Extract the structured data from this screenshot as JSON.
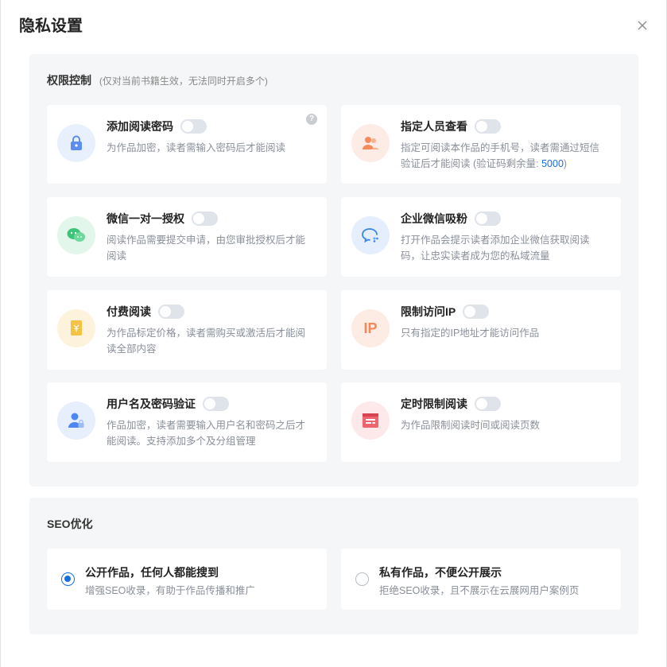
{
  "dialog": {
    "title": "隐私设置"
  },
  "permission": {
    "title": "权限控制",
    "note": "(仅对当前书籍生效，无法同时开启多个)",
    "cards": [
      {
        "title": "添加阅读密码",
        "desc": "为作品加密，读者需输入密码后才能阅读",
        "icon": "lock-icon",
        "enabled": false,
        "help": "?"
      },
      {
        "title": "指定人员查看",
        "desc_before": "指定可阅读本作品的手机号，读者需通过短信验证后才能阅读 (验证码剩余量: ",
        "quota": "5000",
        "desc_after": ")",
        "icon": "people-icon",
        "enabled": false
      },
      {
        "title": "微信一对一授权",
        "desc": "阅读作品需要提交申请，由您审批授权后才能阅读",
        "icon": "wechat-icon",
        "enabled": false
      },
      {
        "title": "企业微信吸粉",
        "desc": "打开作品会提示读者添加企业微信获取阅读码，让忠实读者成为您的私域流量",
        "icon": "work-wechat-icon",
        "enabled": false
      },
      {
        "title": "付费阅读",
        "desc": "为作品标定价格，读者需购买或激活后才能阅读全部内容",
        "icon": "paid-book-icon",
        "enabled": false
      },
      {
        "title": "限制访问IP",
        "desc": "只有指定的IP地址才能访问作品",
        "icon": "ip-icon",
        "icon_text": "IP",
        "enabled": false
      },
      {
        "title": "用户名及密码验证",
        "desc": "作品加密，读者需要输入用户名和密码之后才能阅读。支持添加多个及分组管理",
        "icon": "user-lock-icon",
        "enabled": false
      },
      {
        "title": "定时限制阅读",
        "desc": "为作品限制阅读时间或阅读页数",
        "icon": "calendar-icon",
        "enabled": false
      }
    ]
  },
  "seo": {
    "title": "SEO优化",
    "options": [
      {
        "title": "公开作品，任何人都能搜到",
        "desc": "增强SEO收录，有助于作品传播和推广",
        "checked": true
      },
      {
        "title": "私有作品，不便公开展示",
        "desc": "拒绝SEO收录，且不展示在云展网用户案例页",
        "checked": false
      }
    ]
  },
  "colors": {
    "accent": "#1a6fe0",
    "panel": "#f5f6f7",
    "toggle_off": "#dfe3ea"
  }
}
